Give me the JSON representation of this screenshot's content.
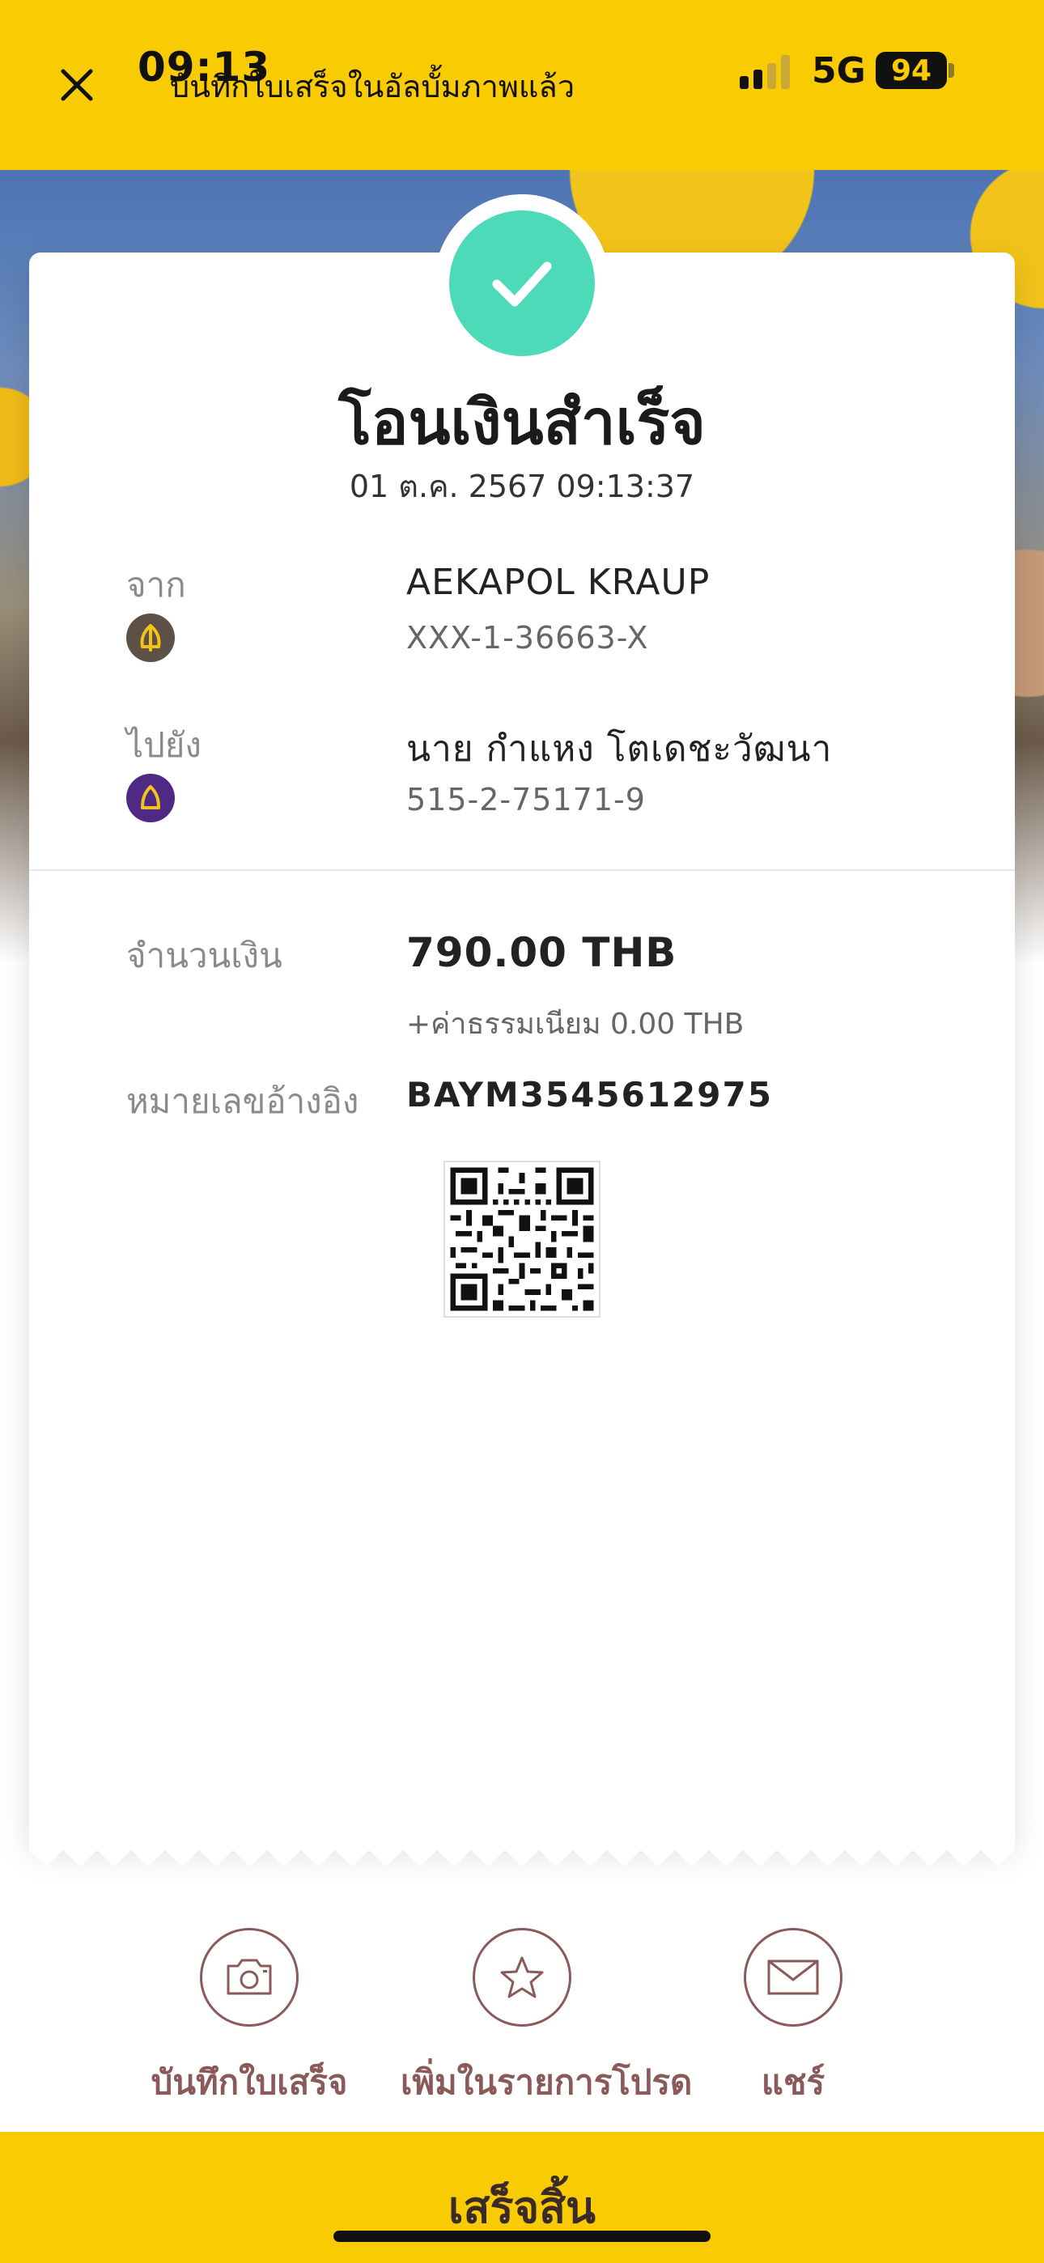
{
  "status_bar": {
    "time": "09:13",
    "network": "5G",
    "battery": "94"
  },
  "toast": "บันทึกใบเสร็จในอัลบั้มภาพแล้ว",
  "receipt": {
    "title": "โอนเงินสำเร็จ",
    "datetime": "01 ต.ค. 2567 09:13:37",
    "from": {
      "label": "จาก",
      "name": "AEKAPOL KRAUP",
      "account": "XXX-1-36663-X",
      "bank_icon": "kbank-icon"
    },
    "to": {
      "label": "ไปยัง",
      "name": "นาย กำแหง โตเดชะวัฒนา",
      "account": "515-2-75171-9",
      "bank_icon": "scb-icon"
    },
    "amount": {
      "label": "จำนวนเงิน",
      "value": "790.00 THB",
      "fee": "+ค่าธรรมเนียม 0.00 THB"
    },
    "reference": {
      "label": "หมายเลขอ้างอิง",
      "value": "BAYM3545612975"
    }
  },
  "actions": [
    {
      "label": "บันทึกใบเสร็จ",
      "icon": "camera-icon"
    },
    {
      "label": "เพิ่มในรายการโปรด",
      "icon": "star-icon"
    },
    {
      "label": "แชร์",
      "icon": "mail-icon"
    }
  ],
  "done_button": "เสร็จสิ้น",
  "colors": {
    "brand_yellow": "#F9CB02",
    "success_green": "#4DDAB9",
    "action_brown": "#8a5a5a"
  }
}
